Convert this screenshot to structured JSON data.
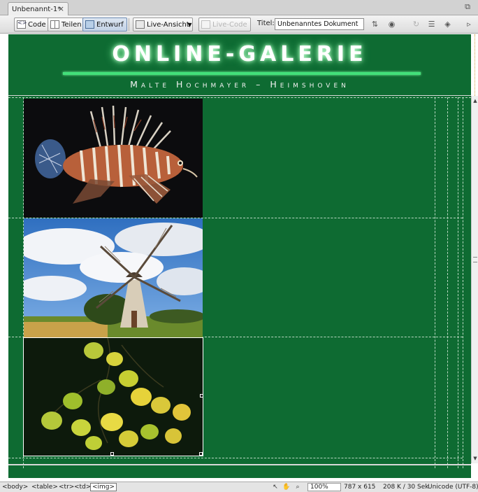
{
  "document_tab": {
    "title": "Unbenannt-1*",
    "close_glyph": "×"
  },
  "window_controls": {
    "restore_icon": "restore-icon"
  },
  "toolbar": {
    "code_label": "Code",
    "split_label": "Teilen",
    "design_label": "Entwurf",
    "live_view_label": "Live-Ansicht",
    "live_code_label": "Live-Code",
    "title_label": "Titel:",
    "title_value": "Unbenanntes Dokument",
    "icons": [
      "file-management-icon",
      "browser-preview-icon",
      "refresh-icon",
      "view-options-icon",
      "visual-aids-icon",
      "validate-icon"
    ]
  },
  "page": {
    "title": "ONLINE-GALERIE",
    "subtitle": "Malte Hochmayer – Heimshoven",
    "background": "#0e6b32",
    "accent": "#42e07a",
    "images": [
      {
        "subject": "lionfish"
      },
      {
        "subject": "windmill"
      },
      {
        "subject": "autumn-leaves",
        "selected": true
      }
    ]
  },
  "statusbar": {
    "tags": [
      "<body>",
      "<table>",
      "<tr>",
      "<td>",
      "<img>"
    ],
    "zoom": "100%",
    "dimensions": "787 x 615",
    "download": "208 K / 30 Sek",
    "encoding": "Unicode (UTF-8)"
  }
}
